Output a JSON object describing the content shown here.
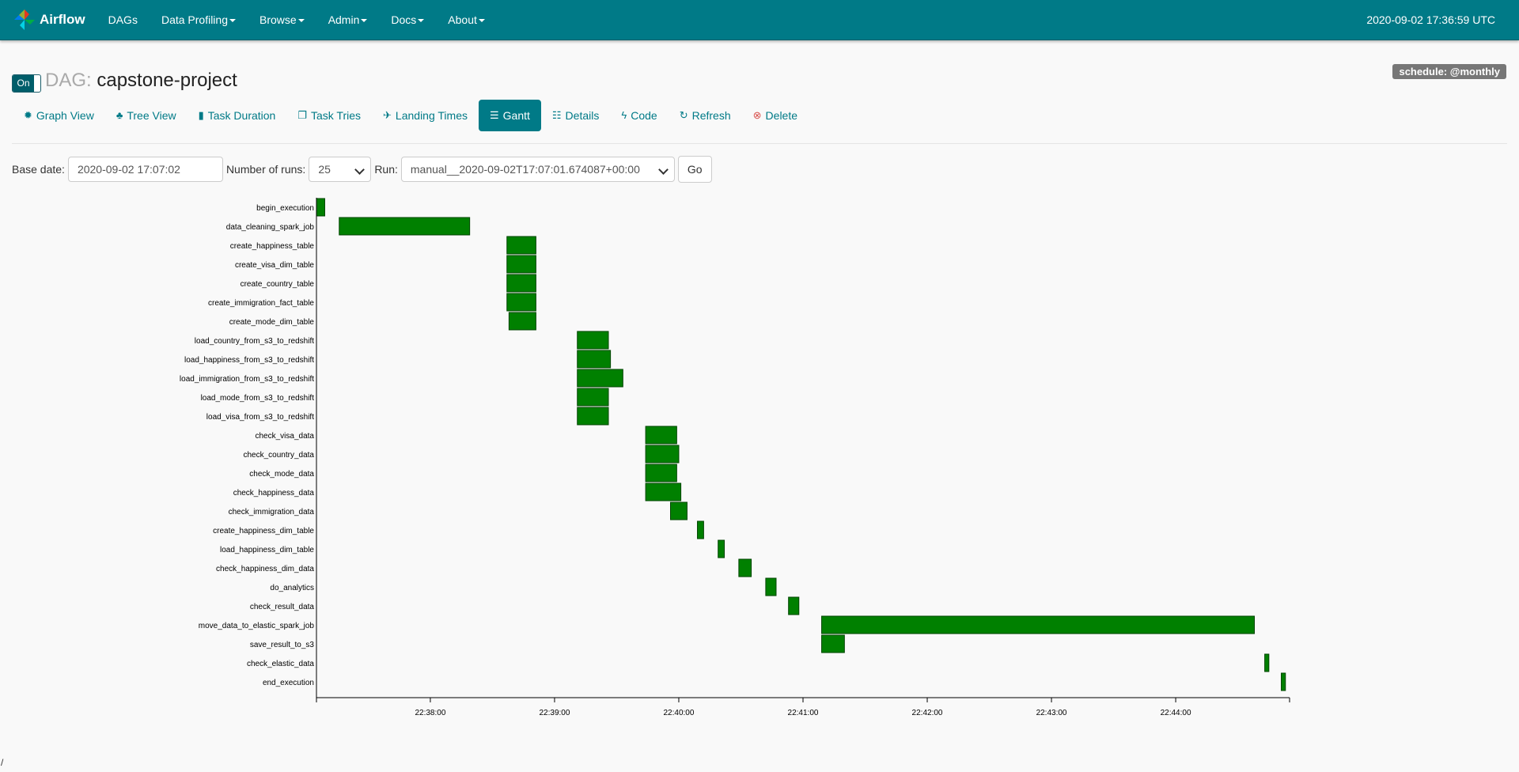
{
  "navbar": {
    "brand": "Airflow",
    "items": [
      {
        "label": "DAGs",
        "dropdown": false
      },
      {
        "label": "Data Profiling",
        "dropdown": true
      },
      {
        "label": "Browse",
        "dropdown": true
      },
      {
        "label": "Admin",
        "dropdown": true
      },
      {
        "label": "Docs",
        "dropdown": true
      },
      {
        "label": "About",
        "dropdown": true
      }
    ],
    "time": "2020-09-02 17:36:59 UTC"
  },
  "dag": {
    "toggle_label": "On",
    "label": "DAG:",
    "name": "capstone-project",
    "schedule": "schedule: @monthly"
  },
  "tabs": [
    {
      "label": "Graph View",
      "icon": "asterisk-icon",
      "glyph": "✹",
      "active": false
    },
    {
      "label": "Tree View",
      "icon": "tree-icon",
      "glyph": "♣",
      "active": false
    },
    {
      "label": "Task Duration",
      "icon": "bar-chart-icon",
      "glyph": "▮",
      "active": false
    },
    {
      "label": "Task Tries",
      "icon": "duplicate-icon",
      "glyph": "❐",
      "active": false
    },
    {
      "label": "Landing Times",
      "icon": "plane-icon",
      "glyph": "✈",
      "active": false
    },
    {
      "label": "Gantt",
      "icon": "align-left-icon",
      "glyph": "☰",
      "active": true
    },
    {
      "label": "Details",
      "icon": "list-icon",
      "glyph": "☷",
      "active": false
    },
    {
      "label": "Code",
      "icon": "flash-icon",
      "glyph": "ϟ",
      "active": false
    },
    {
      "label": "Refresh",
      "icon": "refresh-icon",
      "glyph": "↻",
      "active": false
    },
    {
      "label": "Delete",
      "icon": "remove-circle-icon",
      "glyph": "⊗",
      "active": false
    }
  ],
  "form": {
    "base_date_label": "Base date:",
    "base_date_value": "2020-09-02 17:07:02",
    "num_runs_label": "Number of runs:",
    "num_runs_value": "25",
    "run_label": "Run:",
    "run_value": "manual__2020-09-02T17:07:01.674087+00:00",
    "go_label": "Go"
  },
  "colors": {
    "navbar": "#007a87",
    "bar_fill": "#008000",
    "bar_stroke": "#004400"
  },
  "chart_data": {
    "type": "gantt",
    "x_ticks": [
      "22:38:00",
      "22:39:00",
      "22:40:00",
      "22:41:00",
      "22:42:00",
      "22:43:00",
      "22:44:00"
    ],
    "x_start": "22:37:05",
    "x_end": "22:44:55",
    "tasks": [
      {
        "name": "begin_execution",
        "start": "22:37:05",
        "end": "22:37:09"
      },
      {
        "name": "data_cleaning_spark_job",
        "start": "22:37:16",
        "end": "22:38:19"
      },
      {
        "name": "create_happiness_table",
        "start": "22:38:37",
        "end": "22:38:51"
      },
      {
        "name": "create_visa_dim_table",
        "start": "22:38:37",
        "end": "22:38:51"
      },
      {
        "name": "create_country_table",
        "start": "22:38:37",
        "end": "22:38:51"
      },
      {
        "name": "create_immigration_fact_table",
        "start": "22:38:37",
        "end": "22:38:51"
      },
      {
        "name": "create_mode_dim_table",
        "start": "22:38:38",
        "end": "22:38:51"
      },
      {
        "name": "load_country_from_s3_to_redshift",
        "start": "22:39:11",
        "end": "22:39:26"
      },
      {
        "name": "load_happiness_from_s3_to_redshift",
        "start": "22:39:11",
        "end": "22:39:27"
      },
      {
        "name": "load_immigration_from_s3_to_redshift",
        "start": "22:39:11",
        "end": "22:39:33"
      },
      {
        "name": "load_mode_from_s3_to_redshift",
        "start": "22:39:11",
        "end": "22:39:26"
      },
      {
        "name": "load_visa_from_s3_to_redshift",
        "start": "22:39:11",
        "end": "22:39:26"
      },
      {
        "name": "check_visa_data",
        "start": "22:39:44",
        "end": "22:39:59"
      },
      {
        "name": "check_country_data",
        "start": "22:39:44",
        "end": "22:40:00"
      },
      {
        "name": "check_mode_data",
        "start": "22:39:44",
        "end": "22:39:59"
      },
      {
        "name": "check_happiness_data",
        "start": "22:39:44",
        "end": "22:40:01"
      },
      {
        "name": "check_immigration_data",
        "start": "22:39:56",
        "end": "22:40:04"
      },
      {
        "name": "create_happiness_dim_table",
        "start": "22:40:09",
        "end": "22:40:12"
      },
      {
        "name": "load_happiness_dim_table",
        "start": "22:40:19",
        "end": "22:40:22"
      },
      {
        "name": "check_happiness_dim_data",
        "start": "22:40:29",
        "end": "22:40:35"
      },
      {
        "name": "do_analytics",
        "start": "22:40:42",
        "end": "22:40:47"
      },
      {
        "name": "check_result_data",
        "start": "22:40:53",
        "end": "22:40:58"
      },
      {
        "name": "move_data_to_elastic_spark_job",
        "start": "22:41:09",
        "end": "22:44:38"
      },
      {
        "name": "save_result_to_s3",
        "start": "22:41:09",
        "end": "22:41:20"
      },
      {
        "name": "check_elastic_data",
        "start": "22:44:43",
        "end": "22:44:45"
      },
      {
        "name": "end_execution",
        "start": "22:44:51",
        "end": "22:44:53"
      }
    ]
  },
  "footer": {
    "text": "/"
  }
}
